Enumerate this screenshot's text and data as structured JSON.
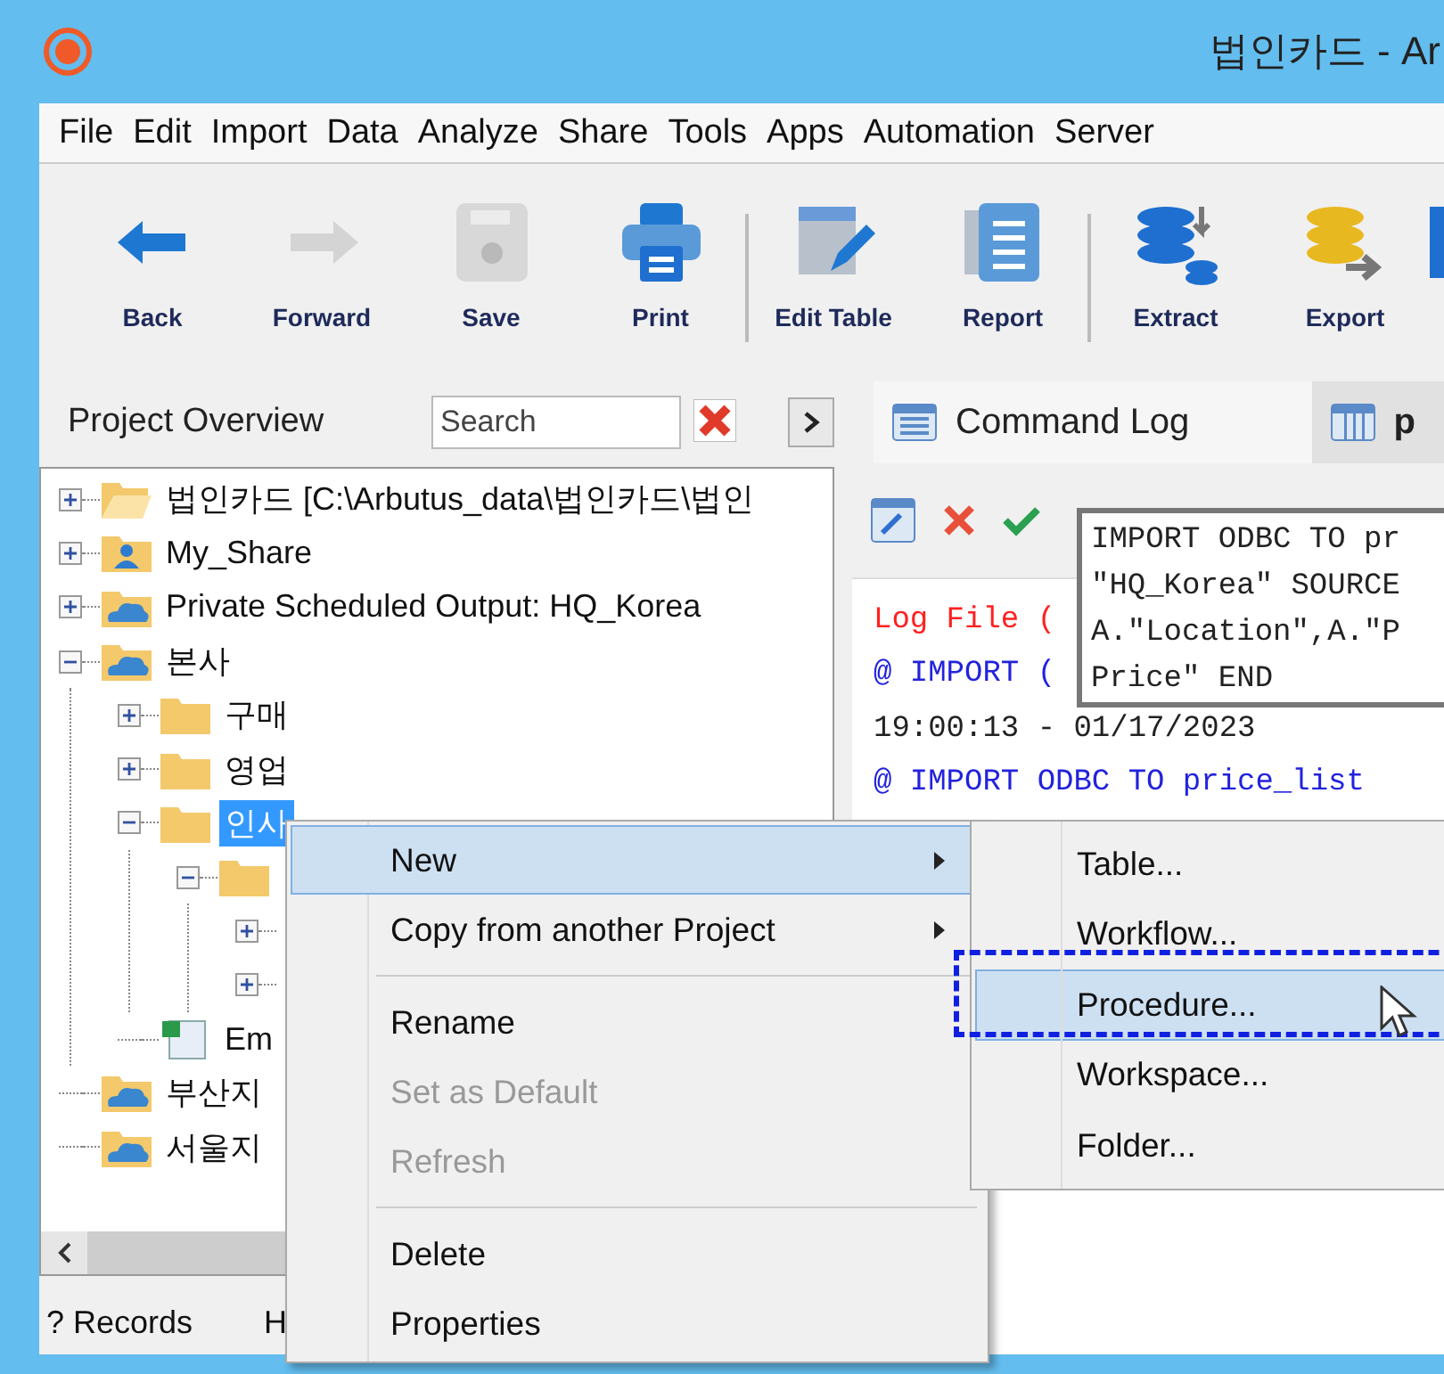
{
  "window": {
    "title": "법인카드 - Ar"
  },
  "menu": [
    "File",
    "Edit",
    "Import",
    "Data",
    "Analyze",
    "Share",
    "Tools",
    "Apps",
    "Automation",
    "Server"
  ],
  "toolbar": [
    {
      "kind": "back",
      "label": "Back",
      "disabled": false
    },
    {
      "kind": "forward",
      "label": "Forward",
      "disabled": true
    },
    {
      "kind": "save",
      "label": "Save",
      "disabled": true
    },
    {
      "kind": "print",
      "label": "Print",
      "disabled": false
    },
    {
      "kind": "edit-table",
      "label": "Edit Table",
      "disabled": false
    },
    {
      "kind": "report",
      "label": "Report",
      "disabled": false
    },
    {
      "kind": "extract",
      "label": "Extract",
      "disabled": false
    },
    {
      "kind": "export",
      "label": "Export",
      "disabled": false
    }
  ],
  "project_panel": {
    "title": "Project Overview",
    "search": {
      "placeholder": "Search"
    },
    "tree": [
      {
        "label": "법인카드 [C:\\Arbutus_data\\법인카드\\법인",
        "kind": "open-folder",
        "expanded": false,
        "selected": false
      },
      {
        "label": "My_Share",
        "kind": "shared",
        "expanded": false,
        "selected": false
      },
      {
        "label": "Private Scheduled Output:  HQ_Korea",
        "kind": "cloud",
        "expanded": false,
        "selected": false
      },
      {
        "label": "본사",
        "kind": "cloud",
        "expanded": true,
        "selected": false,
        "children": [
          {
            "label": "구매",
            "kind": "folder",
            "expanded": false,
            "selected": false
          },
          {
            "label": "영업",
            "kind": "folder",
            "expanded": false,
            "selected": false
          },
          {
            "label": "인사",
            "kind": "folder",
            "expanded": true,
            "selected": true,
            "children": [
              {
                "kind": "folder",
                "expanded": true,
                "children": [
                  {
                    "expanded": false
                  },
                  {
                    "expanded": false
                  }
                ]
              }
            ]
          },
          {
            "label": "Em",
            "kind": "table",
            "selected": false
          }
        ]
      },
      {
        "label": "부산지",
        "kind": "cloud",
        "selected": false
      },
      {
        "label": "서울지",
        "kind": "cloud",
        "selected": false
      }
    ]
  },
  "status_bar": [
    "? Records",
    "H"
  ],
  "editor": {
    "tabs": [
      {
        "label": "Command Log",
        "selected": true
      },
      {
        "label": "p",
        "selected": false
      }
    ],
    "log": [
      {
        "kind": "error",
        "text": "Log File ("
      },
      {
        "kind": "command",
        "text": "@ IMPORT ("
      },
      {
        "kind": "text",
        "text": "19:00:13 - 01/17/2023"
      },
      {
        "kind": "command",
        "text": "@ IMPORT ODBC TO price_list"
      }
    ],
    "tooltip": [
      "IMPORT ODBC TO pr",
      "\"HQ_Korea\" SOURCE",
      "A.\"Location\",A.\"P",
      "Price\" END"
    ]
  },
  "context_menu": {
    "groups": [
      [
        {
          "label": "New",
          "submenu": true,
          "selected": true,
          "disabled": false
        },
        {
          "label": "Copy from another Project",
          "submenu": true,
          "selected": false,
          "disabled": false
        }
      ],
      [
        {
          "label": "Rename",
          "submenu": false,
          "selected": false,
          "disabled": false
        },
        {
          "label": "Set as Default",
          "submenu": false,
          "selected": false,
          "disabled": true
        },
        {
          "label": "Refresh",
          "submenu": false,
          "selected": false,
          "disabled": true
        }
      ],
      [
        {
          "label": "Delete",
          "submenu": false,
          "selected": false,
          "disabled": false
        },
        {
          "label": "Properties",
          "submenu": false,
          "selected": false,
          "disabled": false
        }
      ]
    ]
  },
  "submenu": [
    {
      "label": "Table...",
      "selected": false
    },
    {
      "label": "Workflow...",
      "selected": false
    },
    {
      "label": "Procedure...",
      "selected": true
    },
    {
      "label": "Workspace...",
      "selected": false
    },
    {
      "label": "Folder...",
      "selected": false
    }
  ]
}
